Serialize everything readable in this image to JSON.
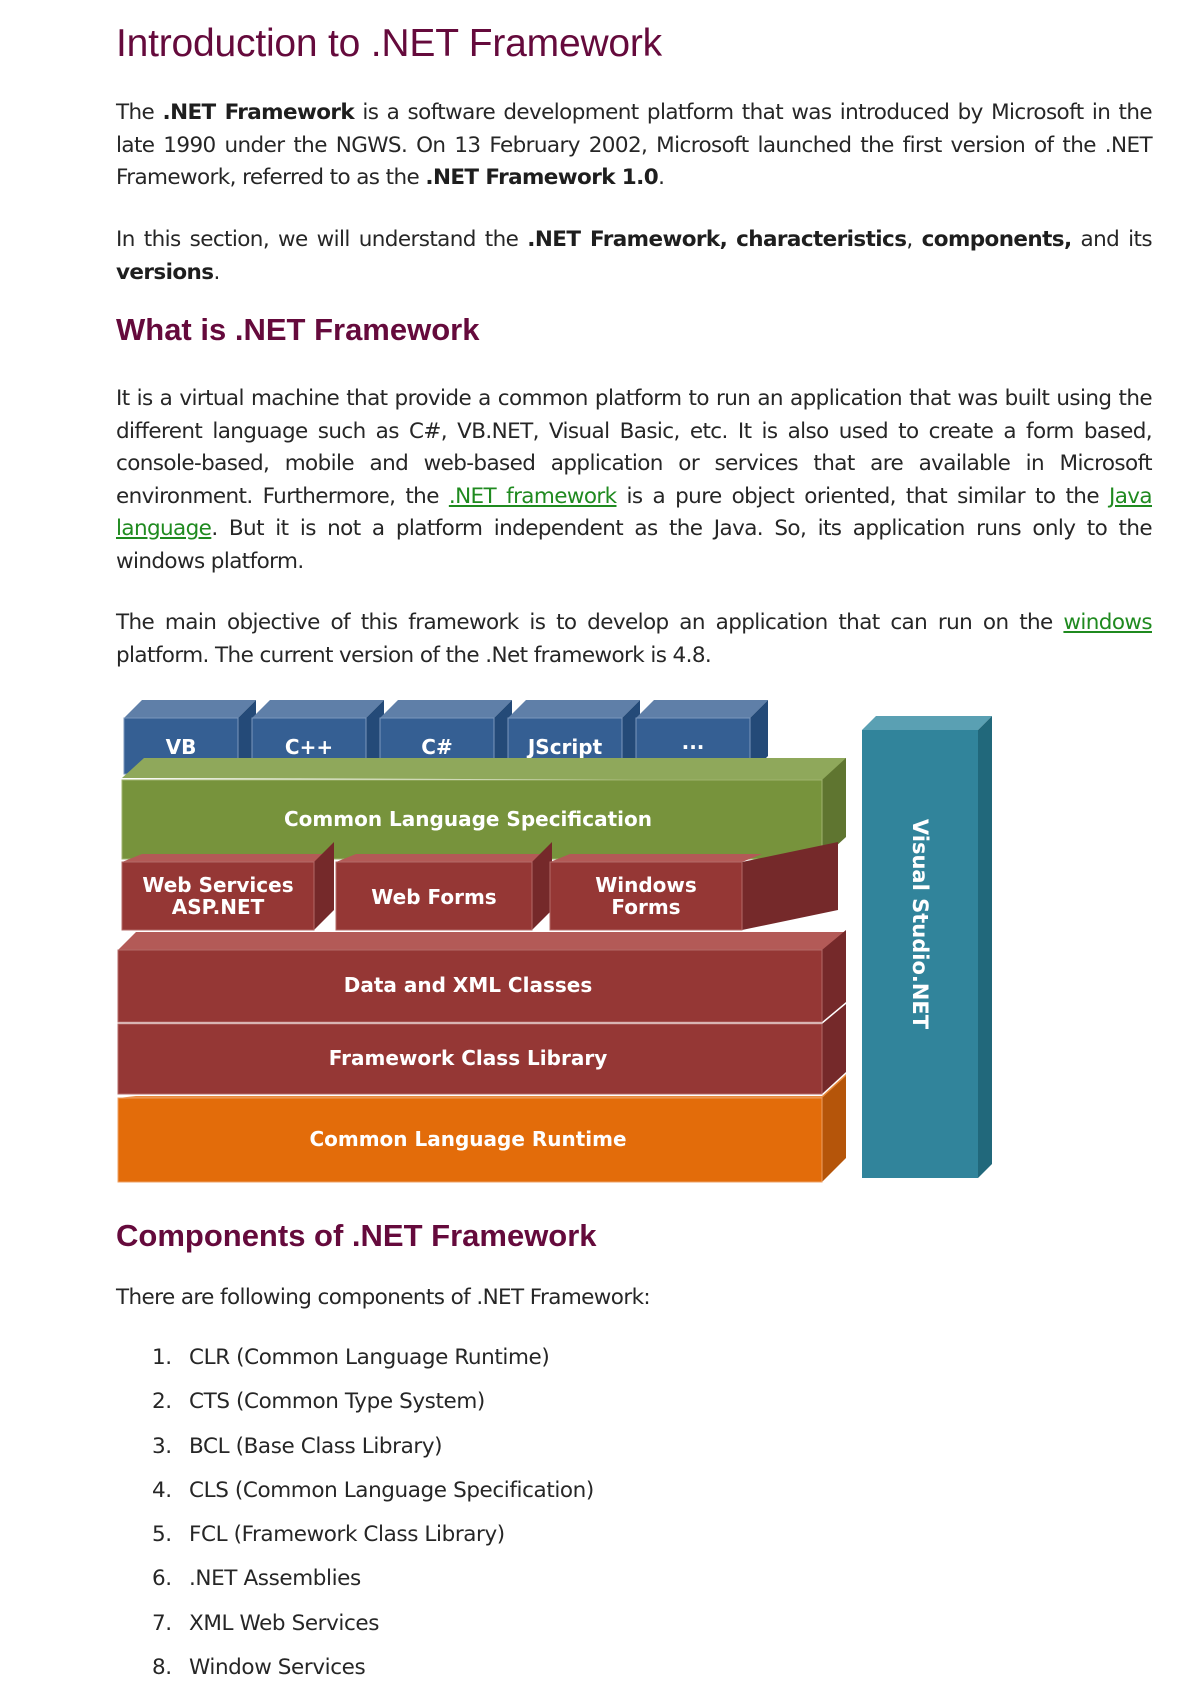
{
  "title": "Introduction to .NET Framework",
  "intro": {
    "p1": {
      "t1": "The ",
      "b1": ".NET Framework",
      "t2": " is a software development platform that was introduced by Microsoft in the late 1990 under the NGWS. On 13 February 2002, Microsoft launched the first version of the .NET Framework, referred to as the ",
      "b2": ".NET Framework 1.0",
      "t3": "."
    },
    "p2": {
      "t1": "In this section, we will understand the ",
      "b1": ".NET Framework,",
      "t2": " ",
      "b2": "characteristics",
      "t3": ", ",
      "b3": "components,",
      "t4": " and its ",
      "b4": "versions",
      "t5": "."
    }
  },
  "what_is": {
    "heading": "What is .NET Framework",
    "p1": {
      "t1": "It is a virtual machine that provide a common platform to run an application that was built using the different language such as C#, VB.NET, Visual Basic, etc. It is also used to create a form based, console-based, mobile and web-based application or services that are available in Microsoft environment. Furthermore, the ",
      "link1": ".NET framework",
      "t2": " is a pure object oriented, that similar to the ",
      "link2": "Java language",
      "t3": ". But it is not a platform independent as the Java. So, its application runs only to the windows platform."
    },
    "p2": {
      "t1": "The main objective of this framework is to develop an application that can run on the ",
      "link1": "windows",
      "t2": " platform. The current version of the .Net framework is 4.8."
    }
  },
  "diagram": {
    "languages": [
      "VB",
      "C++",
      "C#",
      "JScript",
      "···"
    ],
    "cls": "Common Language Specification",
    "apps": [
      {
        "line1": "Web Services",
        "line2": "ASP.NET"
      },
      {
        "line1": "Web Forms",
        "line2": ""
      },
      {
        "line1": "Windows",
        "line2": "Forms"
      }
    ],
    "data_xml": "Data and XML Classes",
    "fcl": "Framework Class Library",
    "clr": "Common Language Runtime",
    "side": "Visual Studio.NET",
    "colors": {
      "blue": "#355f93",
      "green": "#77933c",
      "red": "#953735",
      "orange": "#e36c0a",
      "teal": "#31849b"
    }
  },
  "components": {
    "heading": "Components of .NET Framework",
    "intro": "There are following components of .NET Framework:",
    "items": [
      {
        "num": "1.",
        "text": "CLR (Common Language Runtime)"
      },
      {
        "num": "2.",
        "text": "CTS (Common Type System)"
      },
      {
        "num": "3.",
        "text": "BCL (Base Class Library)"
      },
      {
        "num": "4.",
        "text": "CLS (Common Language Specification)"
      },
      {
        "num": "5.",
        "text": "FCL (Framework Class Library)"
      },
      {
        "num": "6.",
        "text": ".NET Assemblies"
      },
      {
        "num": "7.",
        "text": "XML Web Services"
      },
      {
        "num": "8.",
        "text": "Window Services"
      }
    ]
  }
}
